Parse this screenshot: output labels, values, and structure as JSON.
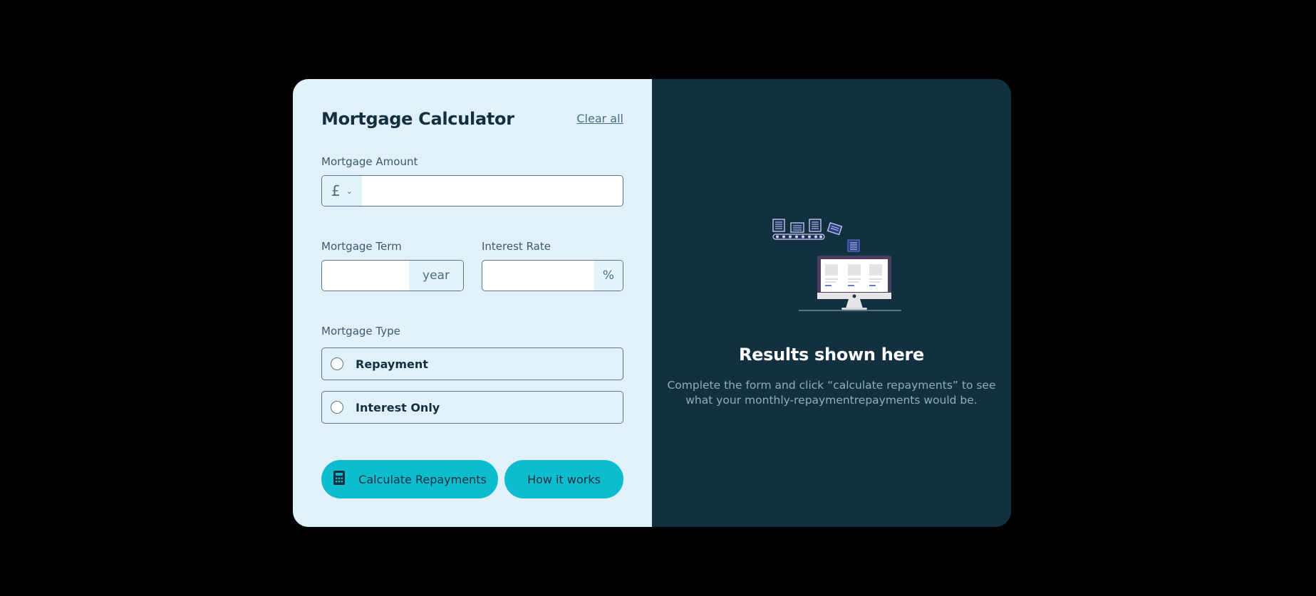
{
  "form": {
    "title": "Mortgage Calculator",
    "clear_label": "Clear all",
    "amount": {
      "label": "Mortgage Amount",
      "currency": "£",
      "value": ""
    },
    "term": {
      "label": "Mortgage Term",
      "unit": "year",
      "value": ""
    },
    "rate": {
      "label": "Interest Rate",
      "unit": "%",
      "value": ""
    },
    "type": {
      "label": "Mortgage Type",
      "options": [
        "Repayment",
        "Interest Only"
      ]
    },
    "calculate_label": "Calculate Repayments",
    "how_label": "How it works"
  },
  "results": {
    "title": "Results shown here",
    "description": "Complete the form and click “calculate repayments” to see what your monthly-repaymentrepayments would be."
  },
  "colors": {
    "background": "#000000",
    "form_bg": "#e0f1fb",
    "results_bg": "#133040",
    "accent": "#0ebccf",
    "text_dark": "#133040"
  },
  "icons": {
    "currency_dropdown": "chevron-down-icon",
    "calculate": "calculator-icon",
    "illustration": "computer-illustration"
  }
}
